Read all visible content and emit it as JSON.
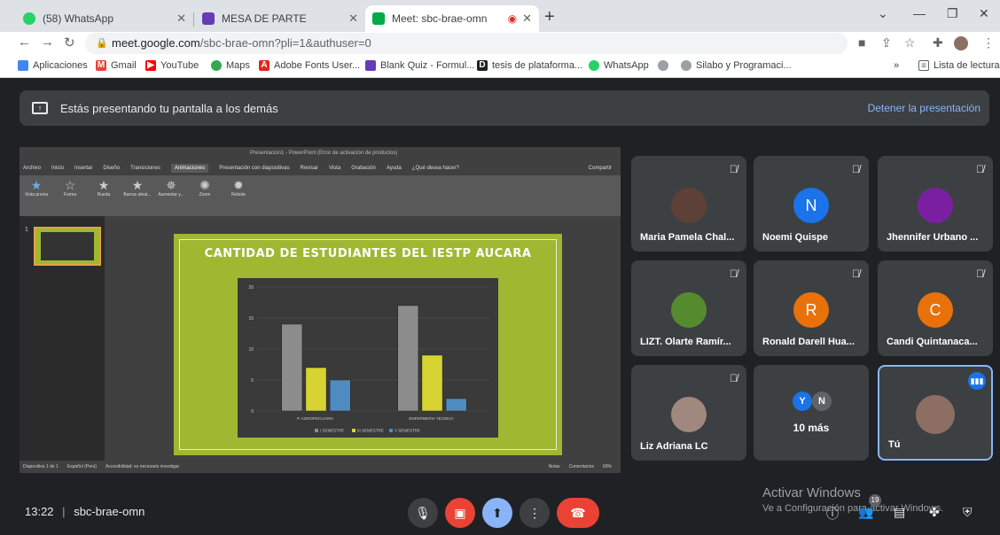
{
  "browser": {
    "tabs": [
      {
        "title": "(58) WhatsApp",
        "badge": "58"
      },
      {
        "title": "MESA DE PARTE"
      },
      {
        "title": "Meet: sbc-brae-omn"
      }
    ],
    "url_host": "meet.google.com",
    "url_path": "/sbc-brae-omn?pli=1&authuser=0",
    "bookmarks": [
      "Aplicaciones",
      "Gmail",
      "YouTube",
      "Maps",
      "Adobe Fonts User...",
      "Blank Quiz - Formul...",
      "tesis de plataforma...",
      "WhatsApp",
      "Silabo y Programaci..."
    ],
    "reading_list": "Lista de lectura",
    "overflow": "»"
  },
  "meet": {
    "banner_text": "Estás presentando tu pantalla a los demás",
    "stop_label": "Detener la presentación",
    "clock": "13:22",
    "separator": "|",
    "meeting_code": "sbc-brae-omn",
    "people_count": "19",
    "watermark_title": "Activar Windows",
    "watermark_sub": "Ve a Configuración para activar Windows."
  },
  "participants": [
    {
      "name": "Maria Pamela Chal...",
      "kind": "photo"
    },
    {
      "name": "Noemi Quispe",
      "initial": "N",
      "color": "#1a73e8"
    },
    {
      "name": "Jhennifer Urbano ...",
      "kind": "photo"
    },
    {
      "name": "LIZT. Olarte Ramír...",
      "kind": "photo"
    },
    {
      "name": "Ronald Darell Hua...",
      "initial": "R",
      "color": "#e8710a"
    },
    {
      "name": "Candi Quintanaca...",
      "initial": "C",
      "color": "#e8710a"
    },
    {
      "name": "Liz Adriana LC",
      "kind": "photo"
    },
    {
      "name": "10 más",
      "initials": [
        "Y",
        "N"
      ]
    },
    {
      "name": "Tú",
      "kind": "self"
    }
  ],
  "powerpoint": {
    "window_title": "Presentación1 - PowerPoint (Error de activación de productos)",
    "ribbon_tabs": [
      "Archivo",
      "Inicio",
      "Insertar",
      "Diseño",
      "Transiciones",
      "Animaciones",
      "Presentación con diapositivas",
      "Revisar",
      "Vista",
      "Grabación",
      "Ayuda",
      "¿Qué desea hacer?"
    ],
    "active_tab": "Animaciones",
    "share": "Compartir",
    "ribbon_items": [
      "Vista previa",
      "Ninguna",
      "Aparecer",
      "Desvanecer",
      "Entrar desde",
      "Flotar hacia",
      "Dividir",
      "Barrido",
      "Forma",
      "Rueda",
      "Barras aleat...",
      "Aumentar y...",
      "Zoom",
      "Rebote"
    ],
    "slide_title": "CANTIDAD DE ESTUDIANTES DEL IESTP AUCARA",
    "status_left": "Diapositiva 1 de 1",
    "status_lang": "Español (Perú)",
    "status_access": "Accesibilidad: es necesario investigar",
    "status_notes": "Notas",
    "status_comments": "Comentarios",
    "zoom": "69%"
  },
  "colors": {
    "slide_bg": "#9fb832",
    "s1": "#8c8c8c",
    "s2": "#d6d332",
    "s3": "#4f8cc0"
  },
  "chart_data": {
    "type": "bar",
    "categories": [
      "P. AGROPECUARIA",
      "ENFERMERIA TECNICA"
    ],
    "series": [
      {
        "name": "I SEMESTRE",
        "values": [
          14,
          17
        ]
      },
      {
        "name": "III SEMESTRE",
        "values": [
          7,
          9
        ]
      },
      {
        "name": "V SEMESTRE",
        "values": [
          5,
          2
        ]
      }
    ],
    "ylim": [
      0,
      20
    ],
    "yticks": [
      0,
      5,
      10,
      15,
      20
    ]
  }
}
